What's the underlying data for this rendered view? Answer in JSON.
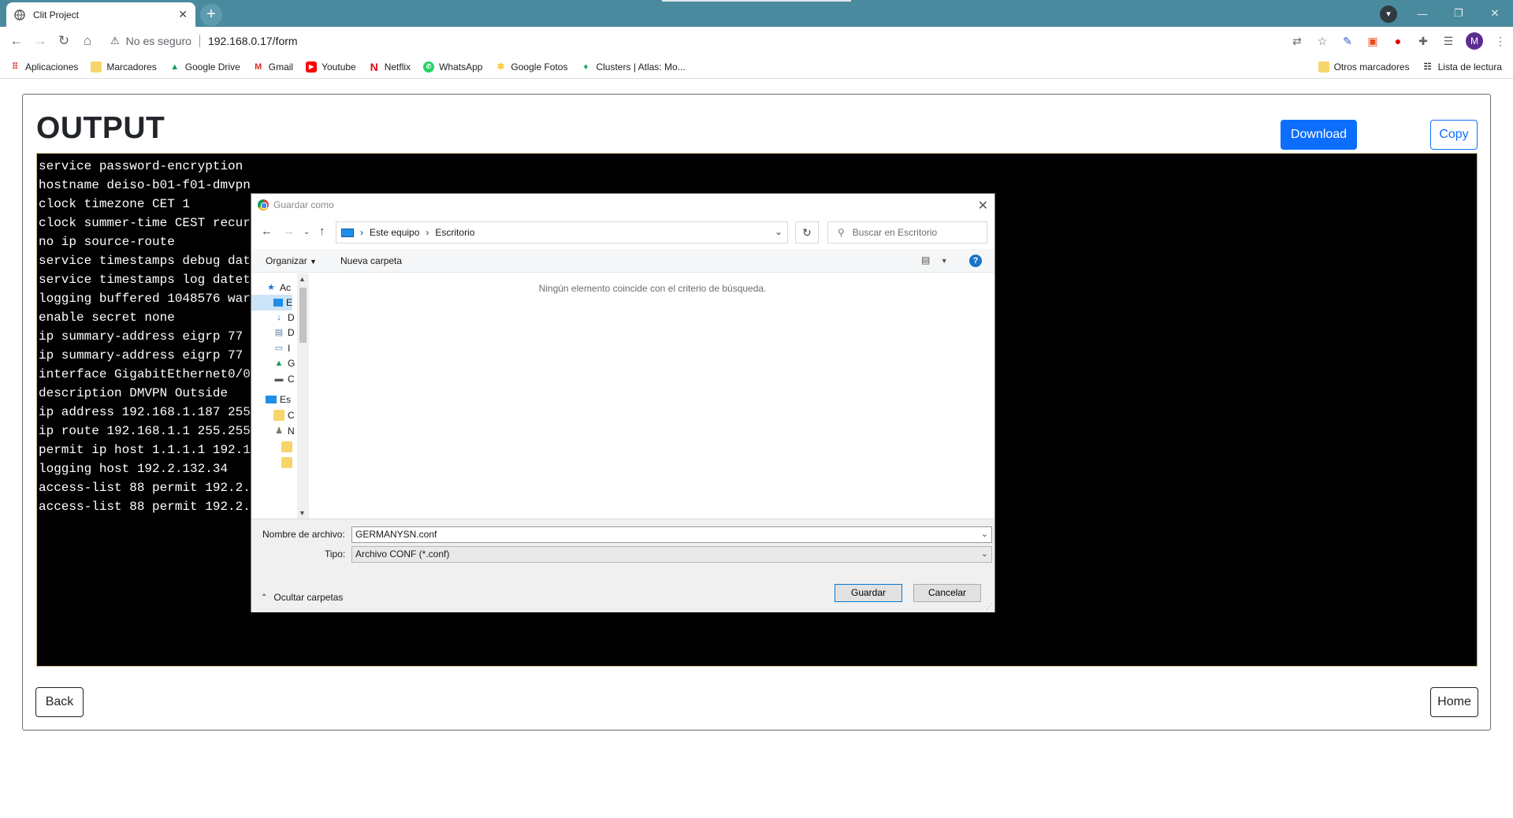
{
  "browser": {
    "tab_title": "Clit Project",
    "security_label": "No es seguro",
    "url": "192.168.0.17/form",
    "profile_initial": "M"
  },
  "bookmarks": {
    "items": [
      {
        "label": "Aplicaciones",
        "icon": "apps-grid-icon"
      },
      {
        "label": "Marcadores",
        "icon": "folder-icon"
      },
      {
        "label": "Google Drive",
        "icon": "drive-icon"
      },
      {
        "label": "Gmail",
        "icon": "gmail-icon"
      },
      {
        "label": "Youtube",
        "icon": "youtube-icon"
      },
      {
        "label": "Netflix",
        "icon": "netflix-icon"
      },
      {
        "label": "WhatsApp",
        "icon": "whatsapp-icon"
      },
      {
        "label": "Google Fotos",
        "icon": "photos-icon"
      },
      {
        "label": "Clusters | Atlas: Mo...",
        "icon": "mongodb-icon"
      }
    ],
    "other": "Otros marcadores",
    "reading_list": "Lista de lectura"
  },
  "page": {
    "title": "OUTPUT",
    "download_label": "Download",
    "copy_label": "Copy",
    "back_label": "Back",
    "home_label": "Home",
    "output_lines": [
      "service password-encryption",
      "hostname deiso-b01-f01-dmvpn",
      "clock timezone CET 1",
      "clock summer-time CEST recur",
      "no ip source-route",
      "service timestamps debug date",
      "service timestamps log datet",
      "logging buffered 1048576 war",
      "enable secret none",
      "ip summary-address eigrp 77",
      "ip summary-address eigrp 77",
      "interface GigabitEthernet0/0",
      "description DMVPN Outside",
      "ip address 192.168.1.187 255",
      "ip route 192.168.1.1 255.255",
      "permit ip host 1.1.1.1 192.1",
      "logging host 192.2.132.34",
      "access-list 88 permit 192.2.",
      "access-list 88 permit 192.2."
    ]
  },
  "dialog": {
    "title": "Guardar como",
    "breadcrumb": [
      "Este equipo",
      "Escritorio"
    ],
    "search_placeholder": "Buscar en Escritorio",
    "organize_label": "Organizar",
    "new_folder_label": "Nueva carpeta",
    "empty_message": "Ningún elemento coincide con el criterio de búsqueda.",
    "filename_label": "Nombre de archivo:",
    "filename_value": "GERMANYSN.conf",
    "type_label": "Tipo:",
    "type_value": "Archivo CONF (*.conf)",
    "hide_folders_label": "Ocultar carpetas",
    "save_label": "Guardar",
    "cancel_label": "Cancelar",
    "nav_items": [
      {
        "label": "Ac",
        "icon": "quick-access-star-icon"
      },
      {
        "label": "E",
        "icon": "desktop-icon"
      },
      {
        "label": "D",
        "icon": "downloads-icon"
      },
      {
        "label": "D",
        "icon": "documents-icon"
      },
      {
        "label": "I",
        "icon": "pictures-icon"
      },
      {
        "label": "G",
        "icon": "google-drive-icon"
      },
      {
        "label": "C",
        "icon": "drive-c-icon"
      },
      {
        "label": "Es",
        "icon": "this-pc-icon"
      },
      {
        "label": "C",
        "icon": "folder-icon"
      },
      {
        "label": "N",
        "icon": "user-folder-icon"
      },
      {
        "label": "",
        "icon": "folder-icon"
      },
      {
        "label": "",
        "icon": "folder-icon"
      }
    ]
  }
}
